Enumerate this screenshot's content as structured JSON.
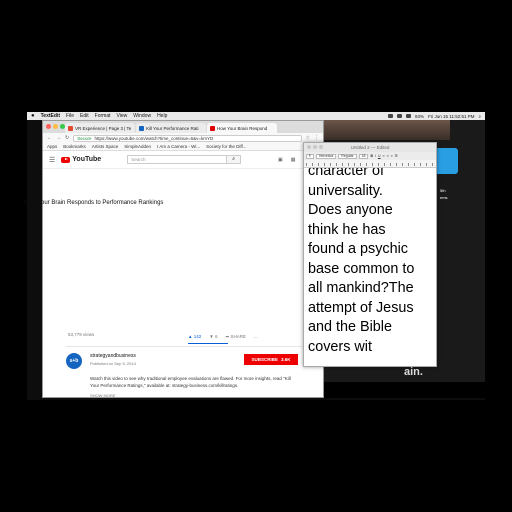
{
  "menubar": {
    "app_name": "TextEdit",
    "items": [
      "File",
      "Edit",
      "Format",
      "View",
      "Window",
      "Help"
    ],
    "clock": "Fri Jun 15 11:52:51 PM",
    "battery": "93%"
  },
  "desktop": {
    "folder_label_1": "5th",
    "folder_label_2": "ems",
    "overlay_text": "ain."
  },
  "chrome": {
    "tabs": [
      {
        "label": "VR Experience | Page 3 | Te",
        "color": "#e34a2f"
      },
      {
        "label": "Kill Your Performance Rati",
        "color": "#1565c0"
      },
      {
        "label": "How Your Brain Respond",
        "color": "#e00000"
      }
    ],
    "url_secure": "Secure",
    "url": "https://www.youtube.com/watch?time_continue=6&v=kmYD",
    "bookmarks": [
      "Apps",
      "Bookmarks",
      "Artists Space",
      "SimpleAdden",
      "I Am a Camera - Wi...",
      "Society for the Diff..."
    ]
  },
  "youtube": {
    "logo": "YouTube",
    "search_placeholder": "Search",
    "video_title": "How Your Brain Responds to Performance Rankings",
    "views": "63,779 views",
    "likes": "142",
    "dislikes": "6",
    "share": "SHARE",
    "more": "...",
    "channel_initials": "s+b",
    "channel_name": "strategyandbusiness",
    "published": "Published on Sep 5, 2014",
    "subscribe": "SUBSCRIBE",
    "subscriber_count": "3.6K",
    "description": "Watch this video to see why traditional employee evaluations are flawed. For more insights, read \"Kill Your Performance Ratings,\" available at: strategy-business.com/killratings.",
    "show_more": "SHOW MORE"
  },
  "textedit": {
    "title": "Untitled 2 — Edited",
    "font_family": "Helvetica",
    "font_style": "Regular",
    "font_size": "18",
    "body": "character of\nuniversality.\nDoes anyone\nthink he has\nfound a psychic\nbase common to\nall mankind?The\nattempt of Jesus\nand the Bible\ncovers wit"
  }
}
